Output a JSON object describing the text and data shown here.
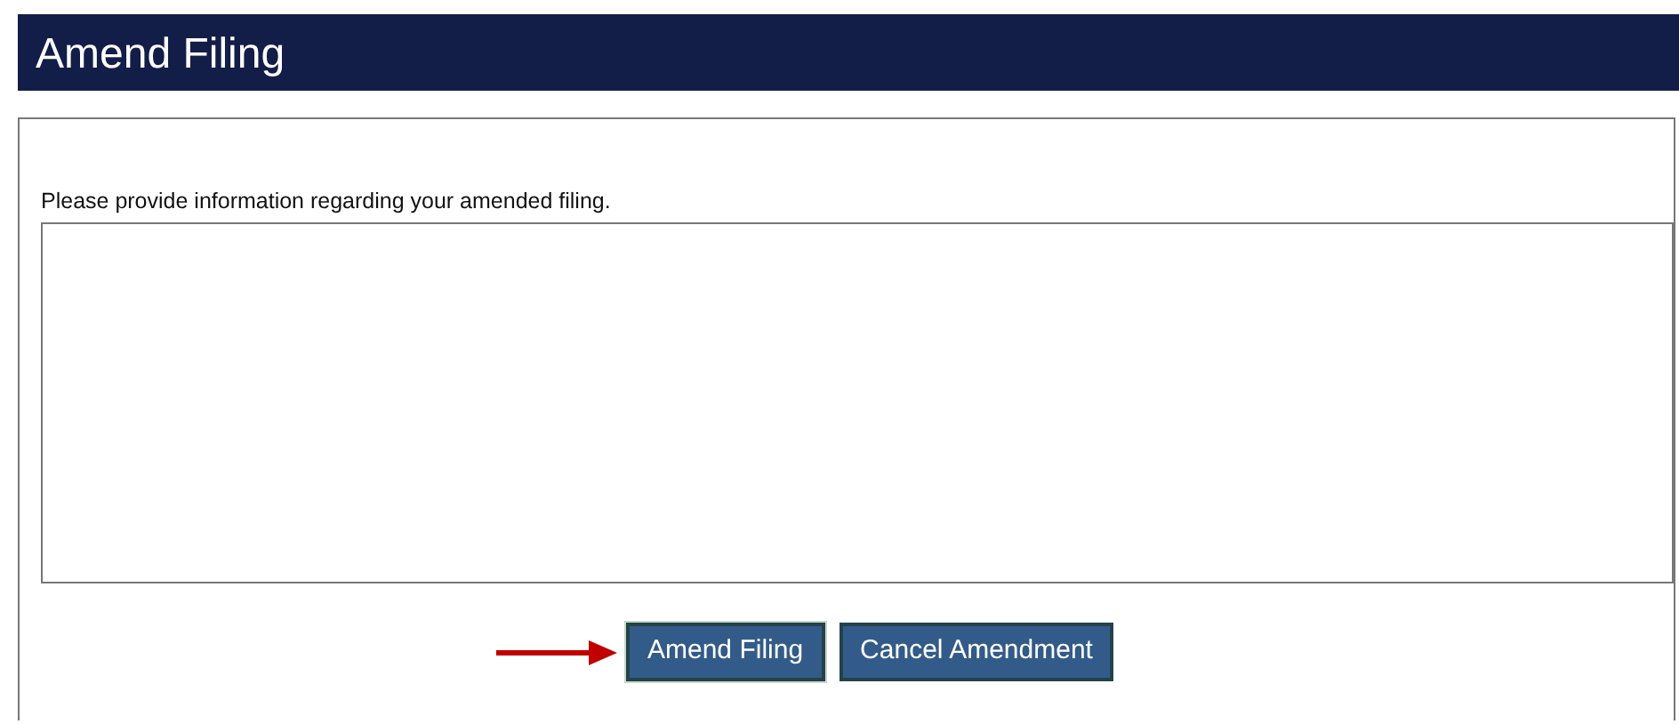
{
  "header": {
    "title": "Amend Filing"
  },
  "form": {
    "prompt": "Please provide information regarding your amended filing.",
    "buttons": [
      {
        "label": "Amend Filing",
        "highlighted": true
      },
      {
        "label": "Cancel Amendment",
        "highlighted": false
      }
    ]
  }
}
